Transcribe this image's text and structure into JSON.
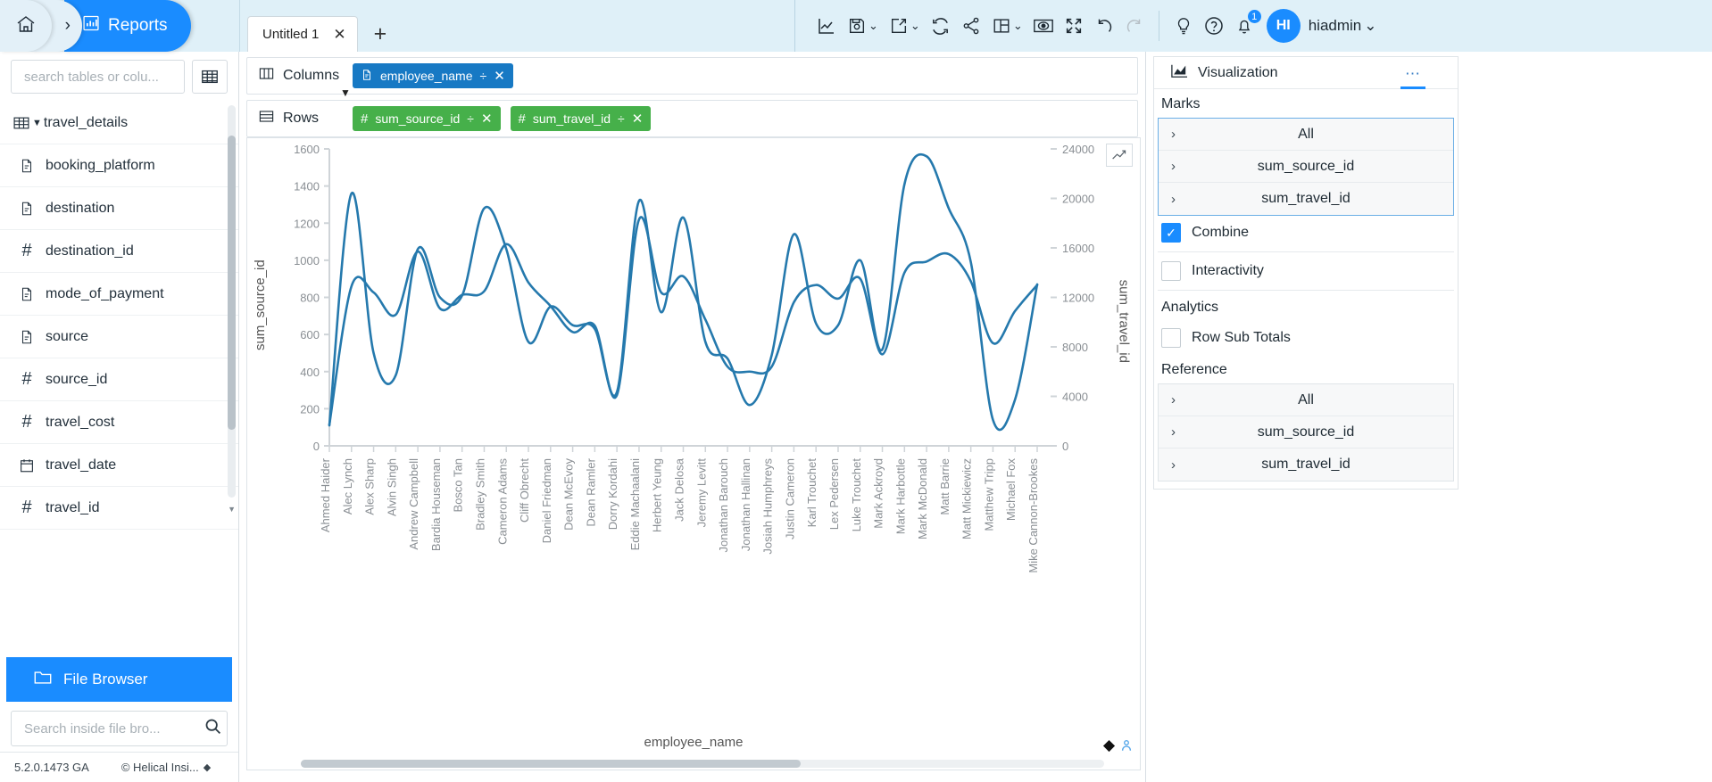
{
  "breadcrumb": {
    "home_icon": "home-icon",
    "separator": "›",
    "active_label": "Reports",
    "active_icon": "bar-chart-icon"
  },
  "tabs": {
    "items": [
      {
        "label": "Untitled 1",
        "close": "✕"
      }
    ],
    "add_label": "+"
  },
  "toolbar": {
    "items": [
      {
        "name": "chart-icon",
        "glyph": "line-chart"
      },
      {
        "name": "save-icon",
        "glyph": "save",
        "caret": "⌄"
      },
      {
        "name": "export-icon",
        "glyph": "export",
        "caret": "⌄"
      },
      {
        "name": "refresh-icon",
        "glyph": "refresh"
      },
      {
        "name": "share-icon",
        "glyph": "share"
      },
      {
        "name": "layout-icon",
        "glyph": "layout",
        "caret": "⌄"
      },
      {
        "name": "preview-icon",
        "glyph": "eye"
      },
      {
        "name": "fullscreen-icon",
        "glyph": "expand"
      },
      {
        "name": "undo-icon",
        "glyph": "undo"
      },
      {
        "name": "redo-icon",
        "glyph": "redo"
      }
    ],
    "help_items": [
      {
        "name": "lightbulb-icon",
        "glyph": "bulb"
      },
      {
        "name": "help-icon",
        "glyph": "question"
      }
    ],
    "notification_count": "1",
    "avatar_initials": "HI",
    "username": "hiadmin",
    "username_caret": "⌄"
  },
  "sidebar": {
    "search_placeholder": "search tables or colu...",
    "grid_icon": "table-grid-icon",
    "table": {
      "label": "travel_details",
      "icon": "table-icon",
      "caret": "▼"
    },
    "fields": [
      {
        "label": "booking_platform",
        "type": "text"
      },
      {
        "label": "destination",
        "type": "text"
      },
      {
        "label": "destination_id",
        "type": "number"
      },
      {
        "label": "mode_of_payment",
        "type": "text"
      },
      {
        "label": "source",
        "type": "text"
      },
      {
        "label": "source_id",
        "type": "number"
      },
      {
        "label": "travel_cost",
        "type": "number"
      },
      {
        "label": "travel_date",
        "type": "date"
      },
      {
        "label": "travel_id",
        "type": "number"
      }
    ],
    "file_browser": {
      "label": "File Browser",
      "icon": "folder-icon"
    },
    "file_search_placeholder": "Search inside file bro...",
    "status": {
      "version": "5.2.0.1473 GA",
      "copyright": "© Helical Insi...",
      "caret": "◆"
    }
  },
  "shelves": {
    "columns": {
      "label": "Columns",
      "icon": "columns-icon",
      "pills": [
        {
          "label": "employee_name",
          "type": "text",
          "color": "blue",
          "divide": "÷",
          "close": "✕"
        }
      ]
    },
    "rows": {
      "label": "Rows",
      "icon": "rows-icon",
      "pills": [
        {
          "label": "sum_source_id",
          "type": "number",
          "color": "green",
          "divide": "÷",
          "close": "✕"
        },
        {
          "label": "sum_travel_id",
          "type": "number",
          "color": "green",
          "divide": "÷",
          "close": "✕"
        }
      ]
    }
  },
  "chart_panel": {
    "chart_type_icon": "trend-line-icon",
    "corner_icons": [
      "diamond-icon",
      "person-icon"
    ]
  },
  "chart_data": {
    "type": "line",
    "title": "",
    "xlabel": "employee_name",
    "ylabel": "sum_source_id",
    "y2label": "sum_travel_id",
    "ylim": [
      0,
      1600
    ],
    "yticks": [
      0,
      200,
      400,
      600,
      800,
      1000,
      1200,
      1400,
      1600
    ],
    "y2lim": [
      0,
      24000
    ],
    "y2ticks": [
      0,
      4000,
      8000,
      12000,
      16000,
      20000,
      24000
    ],
    "grid": false,
    "legend": "none",
    "categories": [
      "Ahmed Haider",
      "Alec Lynch",
      "Alex Sharp",
      "Alvin Singh",
      "Andrew Campbell",
      "Bardia Houseman",
      "Bosco Tan",
      "Bradley Smith",
      "Cameron Adams",
      "Cliff Obrecht",
      "Daniel Friedman",
      "Dean McEvoy",
      "Dean Ramler",
      "Dorry Kordahi",
      "Eddie Machaalani",
      "Herbert Yeung",
      "Jack Delosa",
      "Jeremy Levitt",
      "Jonathan Barouch",
      "Jonathan Hallinan",
      "Josiah Humphreys",
      "Justin Cameron",
      "Karl Trouchet",
      "Lex Pedersen",
      "Luke Trouchet",
      "Mark Ackroyd",
      "Mark Harbottle",
      "Mark McDonald",
      "Matt Barrie",
      "Matt Mickiewicz",
      "Matthew Tripp",
      "Michael Fox",
      "Mike Cannon-Brookes"
    ],
    "series": [
      {
        "name": "sum_source_id",
        "axis": "left",
        "color": "#2579ad",
        "values": [
          110,
          1360,
          500,
          380,
          1060,
          800,
          810,
          1280,
          1060,
          560,
          750,
          650,
          630,
          290,
          1320,
          720,
          1230,
          560,
          470,
          220,
          490,
          1140,
          660,
          650,
          1000,
          520,
          1410,
          1560,
          1280,
          990,
          140,
          250,
          870
        ]
      },
      {
        "name": "sum_travel_id",
        "axis": "right",
        "color": "#2579ad",
        "values": [
          1700,
          12900,
          12400,
          10600,
          15700,
          11100,
          12200,
          12500,
          16300,
          13200,
          11300,
          9200,
          9700,
          4100,
          18300,
          12400,
          13700,
          10200,
          6400,
          6000,
          6400,
          11600,
          13000,
          11900,
          13500,
          7400,
          14000,
          14900,
          15500,
          13300,
          8300,
          10900,
          13000
        ]
      }
    ]
  },
  "right_panel": {
    "viz_title": "Visualization",
    "viz_icon": "chart-icon",
    "viz_dots": "⋯",
    "marks_title": "Marks",
    "marks": [
      {
        "label": "All",
        "chevron": "›"
      },
      {
        "label": "sum_source_id",
        "chevron": "›"
      },
      {
        "label": "sum_travel_id",
        "chevron": "›"
      }
    ],
    "combine": {
      "label": "Combine",
      "checked": true,
      "check_glyph": "✓"
    },
    "interactivity": {
      "label": "Interactivity",
      "checked": false
    },
    "analytics_title": "Analytics",
    "row_sub_totals": {
      "label": "Row Sub Totals",
      "checked": false
    },
    "reference_title": "Reference",
    "references": [
      {
        "label": "All",
        "chevron": "›"
      },
      {
        "label": "sum_source_id",
        "chevron": "›"
      },
      {
        "label": "sum_travel_id",
        "chevron": "›"
      }
    ]
  },
  "colors": {
    "accent": "#1a8cff",
    "topbar_bg": "#dff0f8",
    "pill_blue": "#1779c4",
    "pill_green": "#46b04a",
    "line": "#2579ad"
  }
}
